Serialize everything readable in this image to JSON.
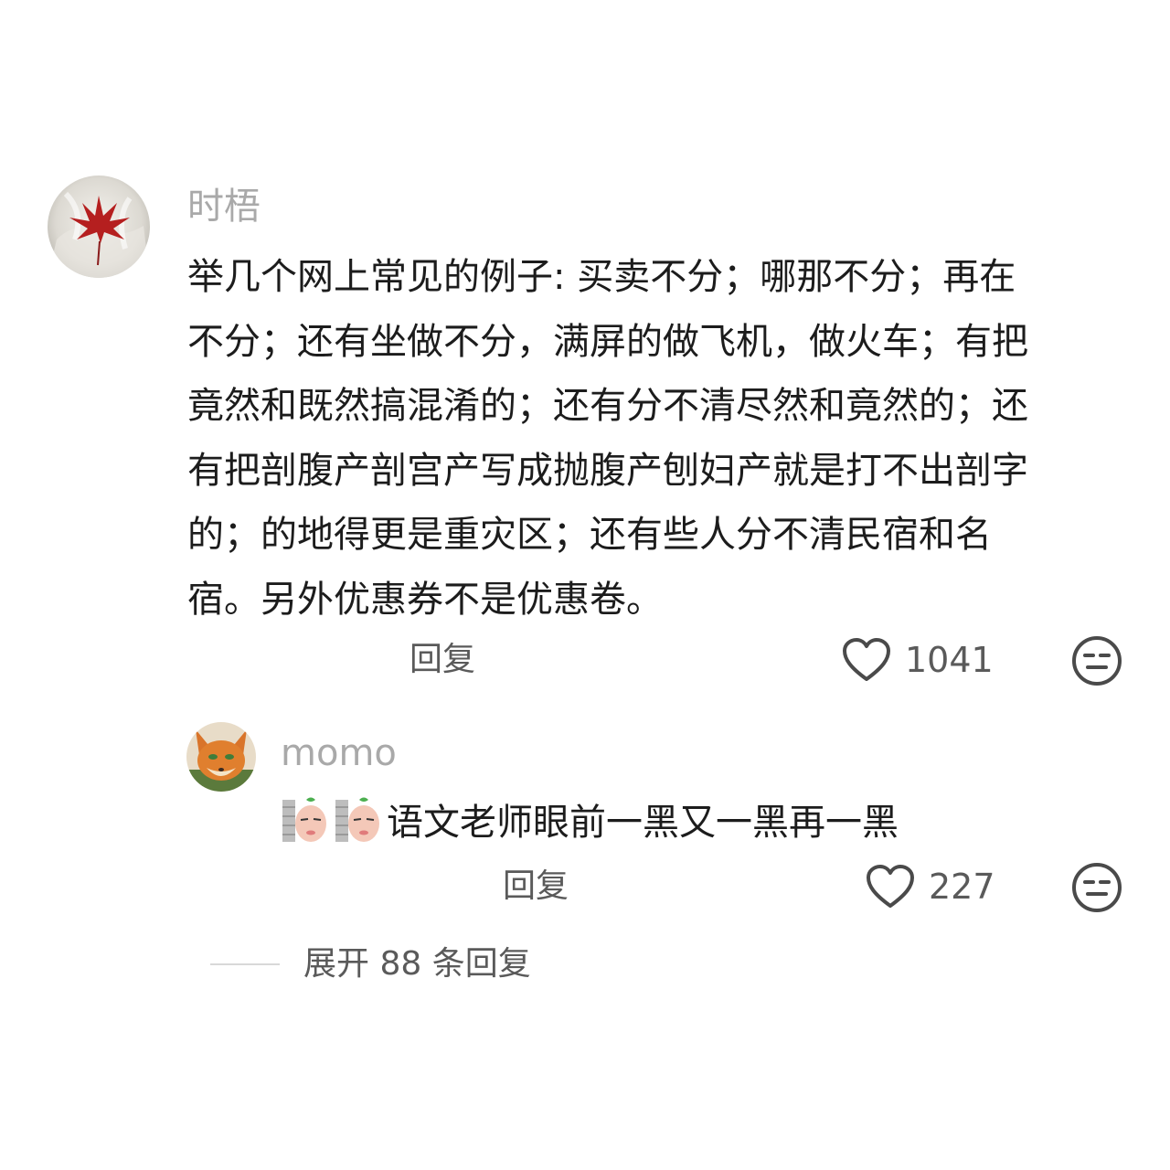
{
  "main_comment": {
    "username": "时梧",
    "avatar_icon": "red-maple-leaf-icon",
    "body_lines": [
      "举几个网上常见的例子: 买卖不分；哪那不分；再在",
      "不分；还有坐做不分，满屏的做飞机，做火车；有把",
      "竟然和既然搞混淆的；还有分不清尽然和竟然的；还",
      "有把剖腹产剖宫产写成抛腹产刨妇产就是打不出剖字",
      "的；的地得更是重灾区；还有些人分不清民宿和名",
      "宿。另外优惠券不是优惠卷。"
    ],
    "reply_label": "回复",
    "like_count": "1041",
    "like_icon": "heart-icon",
    "reaction_icon": "unamused-face-icon"
  },
  "reply_comment": {
    "username": "momo",
    "avatar_icon": "fox-avatar-icon",
    "sticker_icons": [
      "smug-peanut-sticker",
      "smug-peanut-sticker"
    ],
    "body_text": "语文老师眼前一黑又一黑再一黑",
    "reply_label": "回复",
    "like_count": "227",
    "like_icon": "heart-icon",
    "reaction_icon": "unamused-face-icon"
  },
  "expand": {
    "label": "展开 88 条回复"
  },
  "colors": {
    "text_primary": "#1c1c1c",
    "text_secondary": "#5a5a5a",
    "username": "#a9a9a9",
    "background": "#ffffff"
  }
}
